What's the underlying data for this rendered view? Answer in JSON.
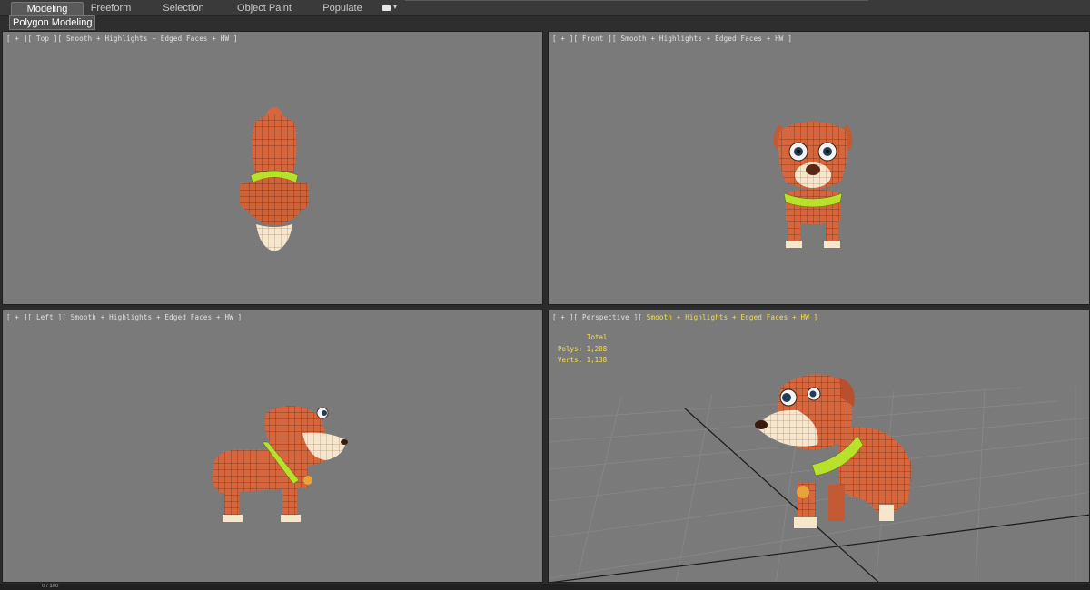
{
  "ribbon": {
    "tabs": [
      {
        "label": "Modeling",
        "active": true
      },
      {
        "label": "Freeform",
        "active": false
      },
      {
        "label": "Selection",
        "active": false
      },
      {
        "label": "Object Paint",
        "active": false
      },
      {
        "label": "Populate",
        "active": false
      }
    ],
    "extra_icon": "camera-icon",
    "subtab": "Polygon Modeling"
  },
  "viewports": {
    "top": {
      "label": "[ + ][ Top ][ Smooth + Highlights + Edged Faces + HW ]"
    },
    "front": {
      "label": "[ + ][ Front ][ Smooth + Highlights + Edged Faces + HW ]"
    },
    "left": {
      "label": "[ + ][ Left ][ Smooth + Highlights + Edged Faces + HW ]"
    },
    "perspective": {
      "label_prefix": "[ + ][ Perspective ][",
      "label_highlight": "Smooth + Highlights + Edged Faces + HW ]",
      "stats_title": "Total",
      "polys": "Polys: 1,208",
      "verts": "Verts: 1,138"
    }
  },
  "status": {
    "frame": "0 / 100"
  },
  "colors": {
    "model_orange": "#d8663c",
    "collar_green": "#b8e12b",
    "viewport_bg": "#7a7a7a",
    "stats_yellow": "#f4e04d"
  }
}
